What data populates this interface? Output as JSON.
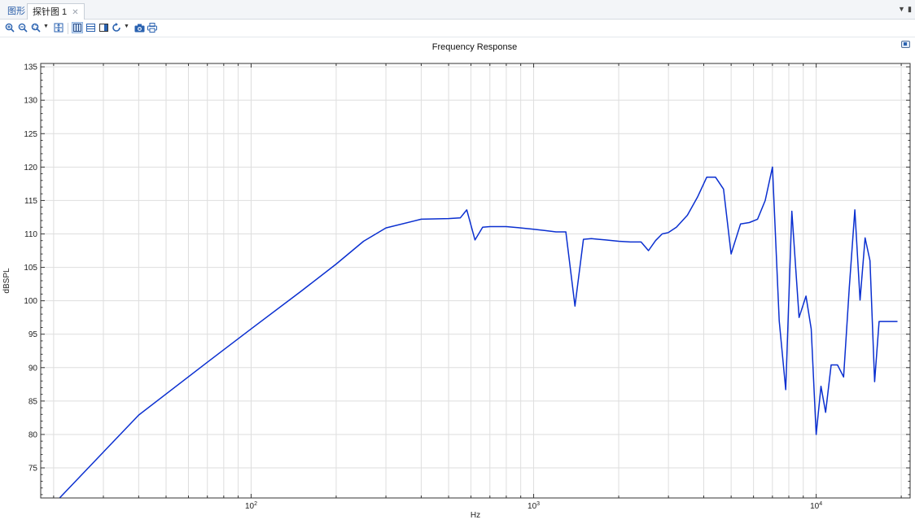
{
  "tabs": [
    {
      "label": "图形"
    },
    {
      "label": "探针图 1"
    }
  ],
  "toolbar": {
    "icons": [
      "zoom-in-icon",
      "zoom-out-icon",
      "zoom-box-icon",
      "zoom-extents-icon",
      "grid-table-icon",
      "list-table-icon",
      "panel-icon",
      "refresh-icon",
      "camera-icon",
      "print-icon"
    ]
  },
  "colors": {
    "line": "#0a2fd0",
    "grid": "#dedede",
    "axis": "#333333"
  },
  "chart_data": {
    "type": "line",
    "title": "Frequency Response",
    "xlabel": "Hz",
    "ylabel": "dBSPL",
    "xscale": "log",
    "xlim": [
      18,
      21500
    ],
    "ylim": [
      70.5,
      135.5
    ],
    "yticks": [
      75,
      80,
      85,
      90,
      95,
      100,
      105,
      110,
      115,
      120,
      125,
      130,
      135
    ],
    "xticks": [
      {
        "value": 100,
        "base": "10",
        "exp": "2"
      },
      {
        "value": 1000,
        "base": "10",
        "exp": "3"
      },
      {
        "value": 10000,
        "base": "10",
        "exp": "4"
      }
    ],
    "grid": true,
    "series": [
      {
        "x": [
          21,
          40,
          70,
          100,
          150,
          200,
          250,
          300,
          400,
          500,
          550,
          580,
          620,
          660,
          700,
          800,
          900,
          1000,
          1100,
          1200,
          1300,
          1400,
          1500,
          1600,
          1700,
          1800,
          2000,
          2200,
          2400,
          2550,
          2700,
          2850,
          3000,
          3200,
          3500,
          3800,
          4100,
          4400,
          4700,
          5000,
          5400,
          5800,
          6200,
          6600,
          7000,
          7400,
          7800,
          8200,
          8700,
          9200,
          9600,
          10000,
          10400,
          10800,
          11300,
          11900,
          12500,
          13100,
          13700,
          14300,
          14900,
          15500,
          16100,
          16700,
          17300,
          18000,
          18700,
          19400
        ],
        "y": [
          70.5,
          82.9,
          90.8,
          95.8,
          101.4,
          105.5,
          108.9,
          110.9,
          112.2,
          112.3,
          112.4,
          113.6,
          109.1,
          111.0,
          111.1,
          111.1,
          110.9,
          110.7,
          110.5,
          110.3,
          110.3,
          99.2,
          109.2,
          109.3,
          109.2,
          109.1,
          108.9,
          108.8,
          108.8,
          107.5,
          109.0,
          110.0,
          110.2,
          111.0,
          112.8,
          115.5,
          118.5,
          118.5,
          116.7,
          107.0,
          111.5,
          111.7,
          112.2,
          115.0,
          120.0,
          97.0,
          86.7,
          113.4,
          97.5,
          100.7,
          95.8,
          80.0,
          87.2,
          83.3,
          90.4,
          90.4,
          88.6,
          102.0,
          113.6,
          100.1,
          109.4,
          106.0,
          87.9,
          96.9,
          96.9,
          96.9,
          96.9,
          96.9
        ]
      }
    ]
  }
}
